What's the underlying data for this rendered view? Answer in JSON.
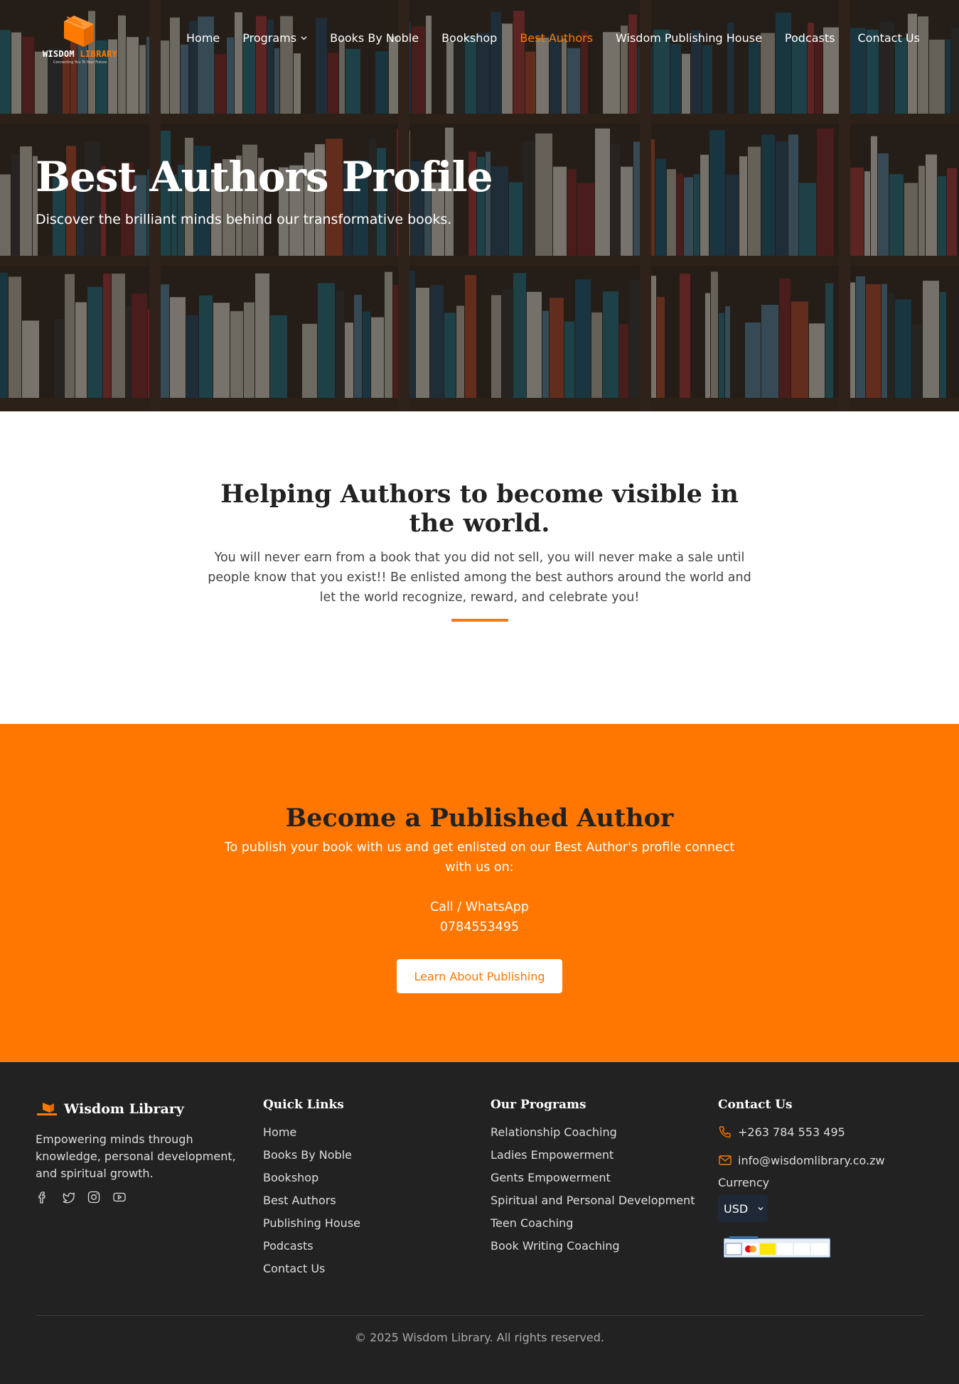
{
  "brand": {
    "logo_word1": "WISDOM",
    "logo_word2": "LIBRARY",
    "logo_tagline": "Connecting You To Your Future",
    "accent_color": "#ff7a00"
  },
  "nav": {
    "items": [
      {
        "label": "Home"
      },
      {
        "label": "Programs"
      },
      {
        "label": "Books By Noble"
      },
      {
        "label": "Bookshop"
      },
      {
        "label": "Best Authors"
      },
      {
        "label": "Wisdom Publishing House"
      },
      {
        "label": "Podcasts"
      },
      {
        "label": "Contact Us"
      }
    ],
    "active": "Best Authors"
  },
  "hero": {
    "title": "Best Authors Profile",
    "subtitle": "Discover the brilliant minds behind our transformative books."
  },
  "intro": {
    "heading": "Helping Authors to become visible in the world.",
    "body": "You will never earn from a book that you did not sell, you will never make a sale until people know that you exist!! Be enlisted among the best authors around the world and let the world recognize, reward, and celebrate you!"
  },
  "cta": {
    "heading": "Become a Published Author",
    "description": "To publish your book with us and get enlisted on our Best Author's profile connect with us on:",
    "call_label": "Call / WhatsApp",
    "phone": "0784553495",
    "button_label": "Learn About Publishing",
    "background_color": "#ff7700"
  },
  "footer": {
    "brand_name": "Wisdom Library",
    "brand_description": "Empowering minds through knowledge, personal development, and spiritual growth.",
    "socials": [
      "facebook-icon",
      "twitter-icon",
      "instagram-icon",
      "youtube-icon"
    ],
    "quick_links": {
      "title": "Quick Links",
      "items": [
        "Home",
        "Books By Noble",
        "Bookshop",
        "Best Authors",
        "Publishing House",
        "Podcasts",
        "Contact Us"
      ]
    },
    "programs": {
      "title": "Our Programs",
      "items": [
        "Relationship Coaching",
        "Ladies Empowerment",
        "Gents Empowerment",
        "Spiritual and Personal Development",
        "Teen Coaching",
        "Book Writing Coaching"
      ]
    },
    "contact": {
      "title": "Contact Us",
      "phone": "+263 784 553 495",
      "email": "info@wisdomlibrary.co.zw",
      "currency_label": "Currency",
      "currency_value": "USD"
    },
    "copyright": "© 2025 Wisdom Library. All rights reserved."
  }
}
